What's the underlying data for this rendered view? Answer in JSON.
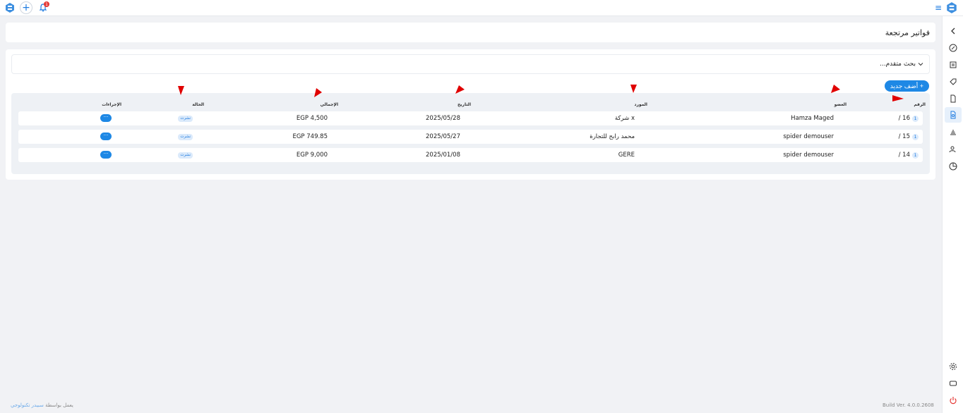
{
  "header": {
    "notification_count": "1"
  },
  "page": {
    "title": "فواتير مرتجعة"
  },
  "search": {
    "advanced_label": "بحث متقدم..."
  },
  "toolbar": {
    "add_label": "+ أضف جديد"
  },
  "table": {
    "headers": {
      "number": "الرقم",
      "member": "العضو",
      "supplier": "المورد",
      "date": "التاريخ",
      "total": "الإجمالي",
      "status": "الحالة",
      "actions": "الإجراءات"
    },
    "rows": [
      {
        "badge": "1",
        "number": "16 /",
        "member": "Hamza Maged",
        "supplier": "شركة x",
        "date": "2025/05/28",
        "total": "EGP 4,500",
        "status": "نشرت",
        "action": "···"
      },
      {
        "badge": "1",
        "number": "15 /",
        "member": "spider demouser",
        "supplier": "محمد رابح للتجارة",
        "date": "2025/05/27",
        "total": "EGP 749.85",
        "status": "نشرت",
        "action": "···"
      },
      {
        "badge": "1",
        "number": "14 /",
        "member": "spider demouser",
        "supplier": "GERE",
        "date": "2025/01/08",
        "total": "EGP 9,000",
        "status": "نشرت",
        "action": "···"
      }
    ]
  },
  "footer": {
    "powered_prefix": "يعمل بواسطة",
    "powered_brand": "سبيدر تكنولوجي",
    "build_version": "Build Ver. 4.0.0.2608"
  },
  "colors": {
    "accent": "#1e88e5",
    "arrow": "#e00000"
  }
}
